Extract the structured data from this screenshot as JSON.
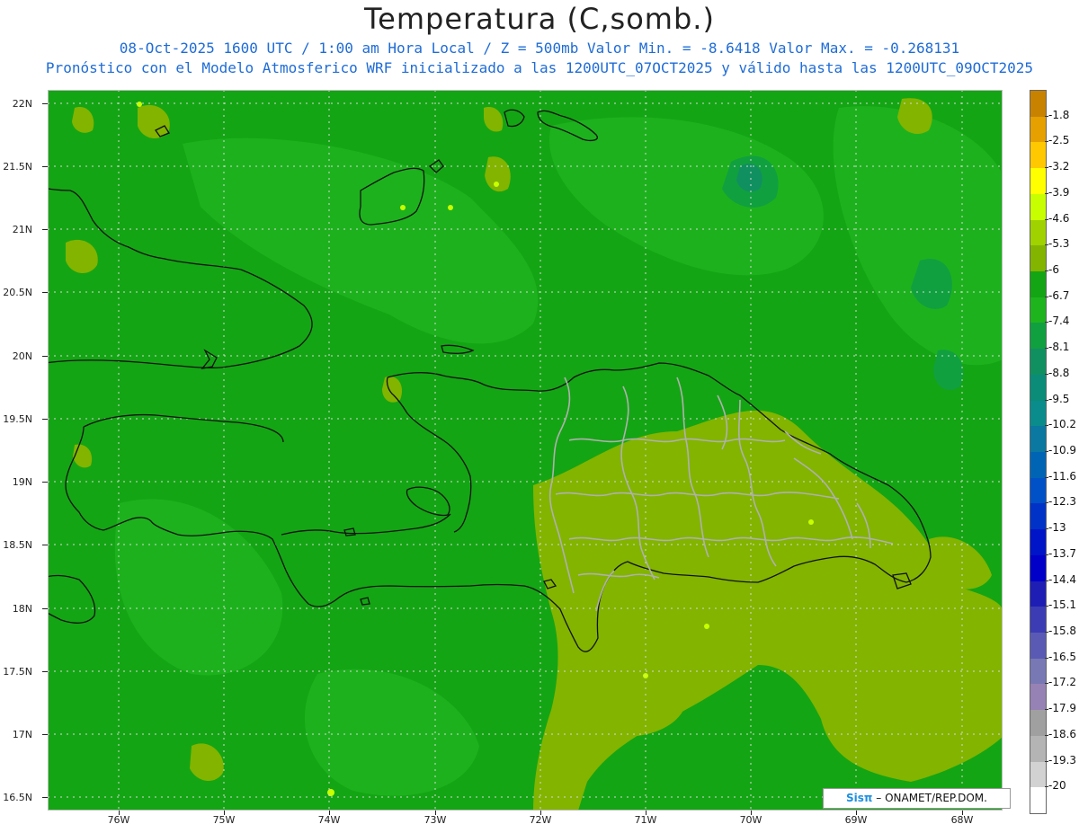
{
  "header": {
    "title": "Temperatura (C,somb.)",
    "subtitle1": "08-Oct-2025  1600 UTC / 1:00 am Hora Local / Z = 500mb  Valor Min. = -8.6418  Valor Max. = -0.268131",
    "subtitle2": "Pronóstico con el Modelo Atmosferico WRF inicializado a las 1200UTC_07OCT2025 y válido hasta las  1200UTC_09OCT2025"
  },
  "axes": {
    "y_labels": [
      "22N",
      "21.5N",
      "21N",
      "20.5N",
      "20N",
      "19.5N",
      "19N",
      "18.5N",
      "18N",
      "17.5N",
      "17N",
      "16.5N"
    ],
    "x_labels": [
      "76W",
      "75W",
      "74W",
      "73W",
      "72W",
      "71W",
      "70W",
      "69W",
      "68W"
    ]
  },
  "credit": {
    "logo": "Sisπ",
    "text": "– ONAMET/REP.DOM."
  },
  "colorbar": {
    "labels": [
      "-1.8",
      "-2.5",
      "-3.2",
      "-3.9",
      "-4.6",
      "-5.3",
      "-6",
      "-6.7",
      "-7.4",
      "-8.1",
      "-8.8",
      "-9.5",
      "-10.2",
      "-10.9",
      "-11.6",
      "-12.3",
      "-13",
      "-13.7",
      "-14.4",
      "-15.1",
      "-15.8",
      "-16.5",
      "-17.2",
      "-17.9",
      "-18.6",
      "-19.3",
      "-20"
    ],
    "colors": [
      "#c88200",
      "#e6a000",
      "#ffc800",
      "#ffff00",
      "#c8ff00",
      "#a0d200",
      "#82b400",
      "#14a514",
      "#1eb41e",
      "#10a040",
      "#109060",
      "#0a8c78",
      "#0a8c8c",
      "#0a78a0",
      "#0064b4",
      "#0050c8",
      "#0032c8",
      "#0014c8",
      "#0000c8",
      "#1e1eb4",
      "#3c3cb4",
      "#5a5ab4",
      "#7878b4",
      "#9682b4",
      "#a0a0a0",
      "#b4b4b4",
      "#d2d2d2",
      "#ffffff"
    ]
  }
}
